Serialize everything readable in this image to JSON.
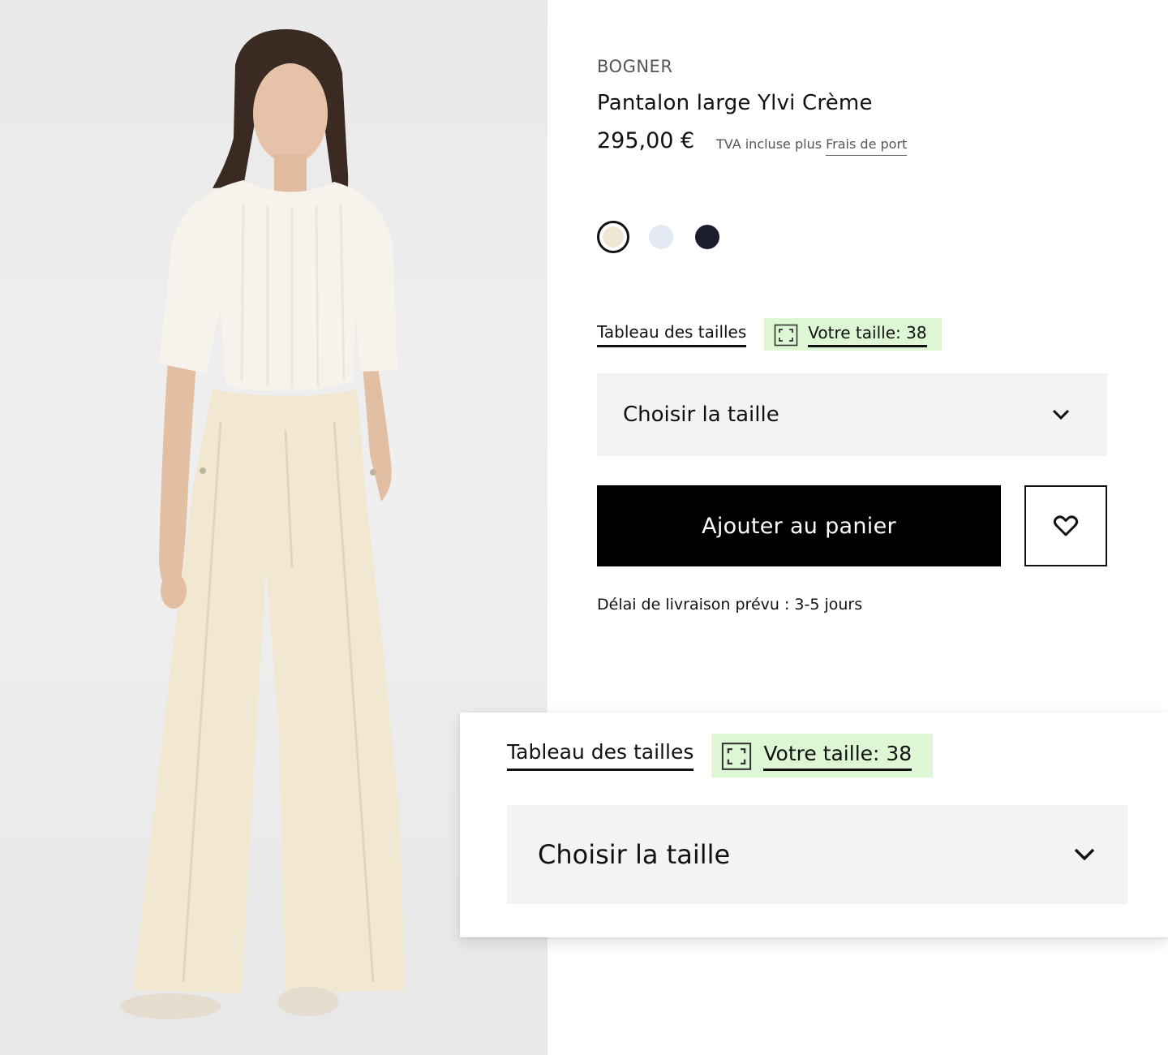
{
  "product": {
    "brand": "BOGNER",
    "title": "Pantalon large Ylvi Crème",
    "price": "295,00 €",
    "tax_text": "TVA incluse plus ",
    "shipping_link": "Frais de port"
  },
  "colors": {
    "swatches": [
      {
        "name": "cream-swatch",
        "color": "#ede6d3",
        "selected": true
      },
      {
        "name": "light-blue-swatch",
        "color": "#e3e9f0",
        "selected": false
      },
      {
        "name": "navy-swatch",
        "color": "#1b1d2c",
        "selected": false
      }
    ]
  },
  "size": {
    "chart_link": "Tableau des tailles",
    "your_size": "Votre taille: 38",
    "select_label": "Choisir la taille"
  },
  "actions": {
    "add_to_cart": "Ajouter au panier"
  },
  "delivery": "Délai de livraison prévu : 3-5 jours",
  "callout": {
    "chart_link": "Tableau des tailles",
    "your_size": "Votre taille: 38",
    "select_label": "Choisir la taille"
  },
  "icons": {
    "size_frame": "size-frame-icon",
    "chevron": "chevron-down-icon",
    "wishlist": "heart-icon"
  },
  "theme": {
    "highlight": "#ddf6d3",
    "button_bg": "#000000",
    "select_bg": "#f3f3f3"
  }
}
